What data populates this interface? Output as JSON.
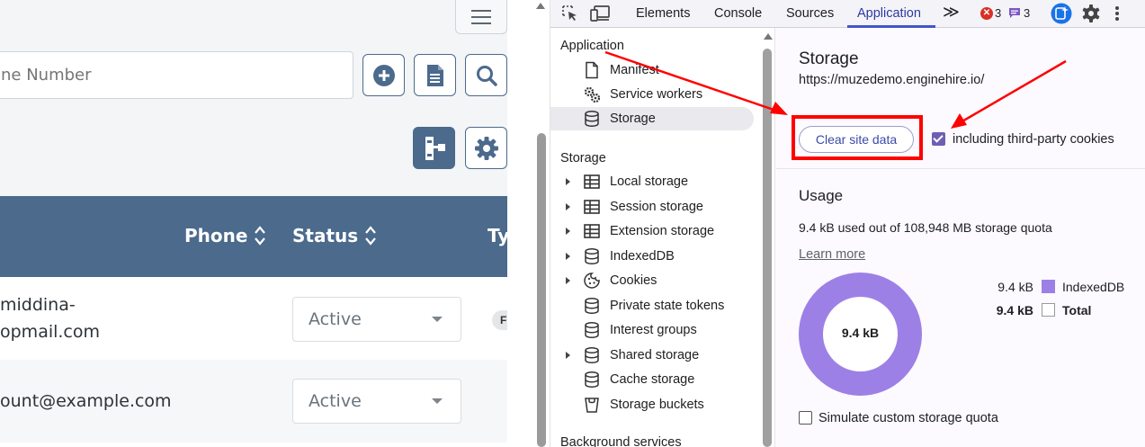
{
  "app": {
    "search_placeholder": "ne Number",
    "table": {
      "headers": [
        "Phone",
        "Status",
        "Ty"
      ],
      "rows": [
        {
          "email_line1": "middina-",
          "email_line2": "opmail.com",
          "status": "Active",
          "type_pill": "F"
        },
        {
          "email_line1": "ount@example.com",
          "email_line2": "",
          "status": "Active",
          "type_pill": ""
        }
      ]
    },
    "buttons": {
      "add": "add-circle-icon",
      "report": "document-icon",
      "search": "search-icon",
      "hierarchy": "hierarchy-icon",
      "settings": "gear-icon",
      "menu": "hamburger-icon"
    }
  },
  "devtools": {
    "tabs": [
      "Elements",
      "Console",
      "Sources",
      "Application"
    ],
    "active_tab": "Application",
    "more_tabs": "≫",
    "errors_count": "3",
    "messages_count": "3",
    "sidebar": {
      "application_header": "Application",
      "application_items": [
        {
          "label": "Manifest",
          "icon": "file-icon"
        },
        {
          "label": "Service workers",
          "icon": "gears-icon"
        },
        {
          "label": "Storage",
          "icon": "database-icon",
          "selected": true
        }
      ],
      "storage_header": "Storage",
      "storage_items": [
        {
          "label": "Local storage",
          "icon": "table-icon",
          "expandable": true
        },
        {
          "label": "Session storage",
          "icon": "table-icon",
          "expandable": true
        },
        {
          "label": "Extension storage",
          "icon": "table-icon",
          "expandable": true
        },
        {
          "label": "IndexedDB",
          "icon": "database-icon",
          "expandable": true
        },
        {
          "label": "Cookies",
          "icon": "cookie-icon",
          "expandable": true
        },
        {
          "label": "Private state tokens",
          "icon": "database-icon",
          "expandable": false
        },
        {
          "label": "Interest groups",
          "icon": "database-icon",
          "expandable": false
        },
        {
          "label": "Shared storage",
          "icon": "database-icon",
          "expandable": true
        },
        {
          "label": "Cache storage",
          "icon": "database-icon",
          "expandable": false
        },
        {
          "label": "Storage buckets",
          "icon": "bucket-icon",
          "expandable": false
        }
      ],
      "background_header": "Background services"
    },
    "main": {
      "title": "Storage",
      "origin": "https://muzedemo.enginehire.io/",
      "clear_button": "Clear site data",
      "third_party_label": "including third-party cookies",
      "third_party_checked": true,
      "usage_title": "Usage",
      "usage_text": "9.4 kB used out of 108,948 MB storage quota",
      "learn_more": "Learn more",
      "donut_center": "9.4 kB",
      "legend": [
        {
          "value": "9.4 kB",
          "label": "IndexedDB",
          "color": "#9d80e6",
          "bold": false
        },
        {
          "value": "9.4 kB",
          "label": "Total",
          "color": "#ffffff",
          "bold": true
        }
      ],
      "simulate_label": "Simulate custom storage quota",
      "simulate_checked": false
    }
  },
  "colors": {
    "app_header": "#4b6a8c",
    "accent": "#4257c7",
    "annotation": "#ff0000",
    "indexeddb": "#9d80e6"
  }
}
